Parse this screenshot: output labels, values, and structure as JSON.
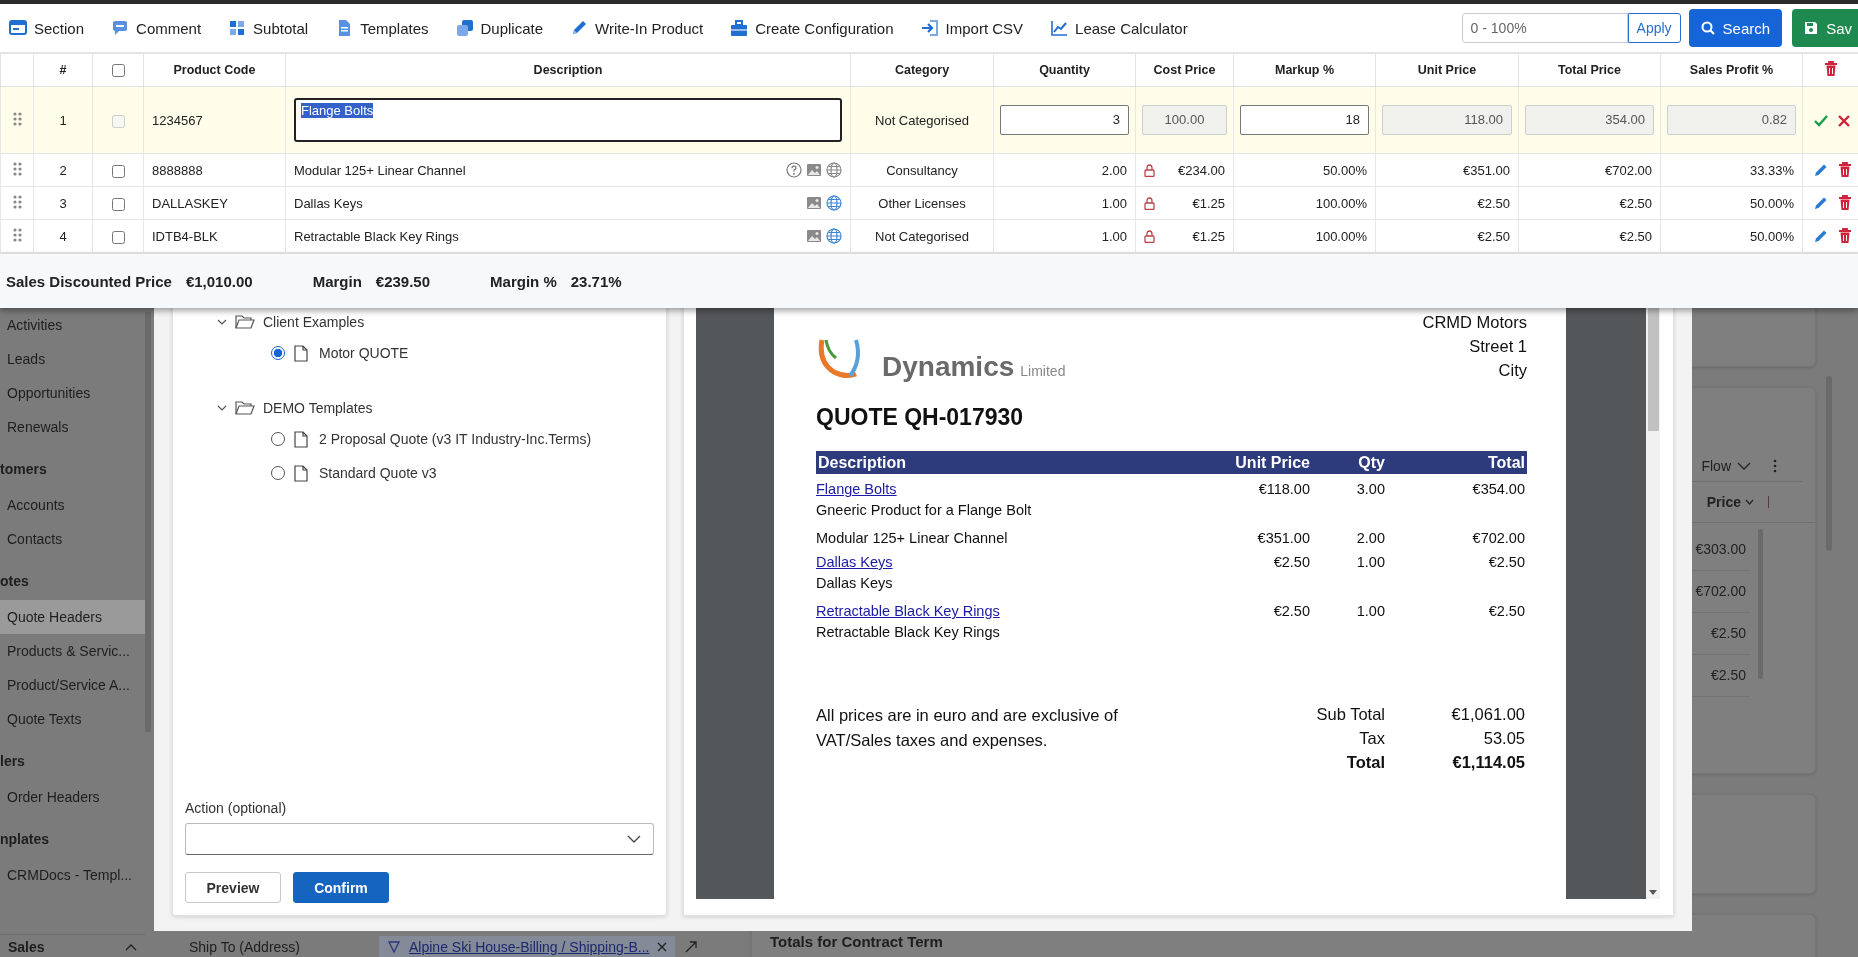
{
  "toolbar": {
    "actions": [
      {
        "label": "Section"
      },
      {
        "label": "Comment"
      },
      {
        "label": "Subtotal"
      },
      {
        "label": "Templates"
      },
      {
        "label": "Duplicate"
      },
      {
        "label": "Write-In Product"
      },
      {
        "label": "Create Configuration"
      },
      {
        "label": "Import CSV"
      },
      {
        "label": "Lease Calculator"
      }
    ],
    "range_field": {
      "placeholder": "0 - 100%"
    },
    "apply": "Apply",
    "search": "Search",
    "save": "Sav"
  },
  "line_items": {
    "columns": [
      "#",
      "Product Code",
      "Description",
      "Category",
      "Quantity",
      "Cost Price",
      "Markup %",
      "Unit Price",
      "Total Price",
      "Sales Profit %"
    ],
    "select_all": {
      "checked": false
    },
    "edit_row": {
      "number": "1",
      "checked": false,
      "checkbox_disabled": true,
      "product_code": "1234567",
      "description": "Flange Bolts",
      "text_selected": true,
      "category": "Not Categorised",
      "fields": [
        {
          "value": "3",
          "disabled": false
        },
        {
          "value": "100.00",
          "disabled": true
        },
        {
          "value": "18",
          "disabled": false
        },
        {
          "value": "118.00",
          "disabled": true
        },
        {
          "value": "354.00",
          "disabled": true
        },
        {
          "value": "0.82",
          "disabled": true
        }
      ]
    },
    "rows": [
      {
        "number": "2",
        "checked": false,
        "product_code": "8888888",
        "description": "Modular 125+ Linear Channel",
        "icons": [
          {
            "kind": "help"
          },
          {
            "kind": "image"
          },
          {
            "kind": "globe",
            "active": false
          }
        ],
        "category": "Consultancy",
        "quantity": "2.00",
        "cost_locked": true,
        "cost_price": "€234.00",
        "markup": "50.00%",
        "unit_price": "€351.00",
        "total_price": "€702.00",
        "sales_profit": "33.33%"
      },
      {
        "number": "3",
        "checked": false,
        "product_code": "DALLASKEY",
        "description": "Dallas Keys",
        "icons": [
          {
            "kind": "image"
          },
          {
            "kind": "globe",
            "active": true
          }
        ],
        "category": "Other Licenses",
        "quantity": "1.00",
        "cost_locked": true,
        "cost_price": "€1.25",
        "markup": "100.00%",
        "unit_price": "€2.50",
        "total_price": "€2.50",
        "sales_profit": "50.00%"
      },
      {
        "number": "4",
        "checked": false,
        "product_code": "IDTB4-BLK",
        "description": "Retractable Black Key Rings",
        "icons": [
          {
            "kind": "image"
          },
          {
            "kind": "globe",
            "active": true
          }
        ],
        "category": "Not Categorised",
        "quantity": "1.00",
        "cost_locked": true,
        "cost_price": "€1.25",
        "markup": "100.00%",
        "unit_price": "€2.50",
        "total_price": "€2.50",
        "sales_profit": "50.00%"
      }
    ]
  },
  "summary": [
    {
      "label": "Sales Discounted Price",
      "value": "€1,010.00"
    },
    {
      "label": "Margin",
      "value": "€239.50"
    },
    {
      "label": "Margin %",
      "value": "23.71%"
    }
  ],
  "background": {
    "sidebar": {
      "items": [
        {
          "kind": "item",
          "label": "Activities",
          "selected": false
        },
        {
          "kind": "item",
          "label": "Leads",
          "selected": false
        },
        {
          "kind": "item",
          "label": "Opportunities",
          "selected": false
        },
        {
          "kind": "item",
          "label": "Renewals",
          "selected": false
        },
        {
          "kind": "heading",
          "label": "tomers"
        },
        {
          "kind": "item",
          "label": "Accounts",
          "selected": false
        },
        {
          "kind": "item",
          "label": "Contacts",
          "selected": false
        },
        {
          "kind": "heading",
          "label": "otes"
        },
        {
          "kind": "item",
          "label": "Quote Headers",
          "selected": true
        },
        {
          "kind": "item",
          "label": "Products & Servic...",
          "selected": false
        },
        {
          "kind": "item",
          "label": "Product/Service A...",
          "selected": false
        },
        {
          "kind": "item",
          "label": "Quote Texts",
          "selected": false
        },
        {
          "kind": "heading",
          "label": "lers"
        },
        {
          "kind": "item",
          "label": "Order Headers",
          "selected": false
        },
        {
          "kind": "heading",
          "label": "nplates"
        },
        {
          "kind": "item",
          "label": "CRMDocs - Templ...",
          "selected": false
        }
      ],
      "area": "Sales"
    },
    "ship_to": {
      "label": "Ship To (Address)",
      "value": "Alpine Ski House-Billing / Shipping-B..."
    },
    "grid_card": {
      "view": "Flow",
      "column": "Price",
      "values": [
        "€303.00",
        "€702.00",
        "€2.50",
        "€2.50"
      ]
    },
    "totals_card": {
      "title": "Totals for Contract Term"
    }
  },
  "dialog": {
    "templates": [
      {
        "label": "Client Examples",
        "expanded": true,
        "children": [
          {
            "label": "Motor QUOTE",
            "selected": true
          }
        ]
      },
      {
        "label": "DEMO Templates",
        "expanded": true,
        "children": [
          {
            "label": "2 Proposal Quote (v3 IT Industry-Inc.Terms)",
            "selected": false
          },
          {
            "label": "Standard Quote v3",
            "selected": false
          }
        ]
      }
    ],
    "action_field": {
      "label": "Action (optional)"
    },
    "buttons": [
      {
        "label": "Preview",
        "kind": "secondary"
      },
      {
        "label": "Confirm",
        "kind": "primary"
      }
    ],
    "document": {
      "logo": {
        "name": "Dynamics",
        "suffix": "Limited"
      },
      "address": [
        "CRMD Motors",
        "Street 1",
        "City"
      ],
      "title": "QUOTE QH-017930",
      "columns": [
        "Description",
        "Unit Price",
        "Qty",
        "Total"
      ],
      "lines": [
        {
          "description": "Flange Bolts",
          "link": true,
          "unit_price": "€118.00",
          "qty": "3.00",
          "total": "€354.00",
          "detail": "Gneeric Product for a Flange Bolt"
        },
        {
          "description": "Modular 125+ Linear Channel",
          "link": false,
          "unit_price": "€351.00",
          "qty": "2.00",
          "total": "€702.00"
        },
        {
          "description": "Dallas Keys",
          "link": true,
          "unit_price": "€2.50",
          "qty": "1.00",
          "total": "€2.50",
          "detail": "Dallas Keys"
        },
        {
          "description": "Retractable Black Key Rings",
          "link": true,
          "unit_price": "€2.50",
          "qty": "1.00",
          "total": "€2.50",
          "detail": "Retractable Black Key Rings"
        }
      ],
      "note": "All prices are in euro and are exclusive of VAT/Sales taxes and expenses.",
      "totals": [
        {
          "label": "Sub Total",
          "value": "€1,061.00",
          "bold": false
        },
        {
          "label": "Tax",
          "value": "53.05",
          "bold": false
        },
        {
          "label": "Total",
          "value": "€1,114.05",
          "bold": true
        }
      ]
    }
  }
}
